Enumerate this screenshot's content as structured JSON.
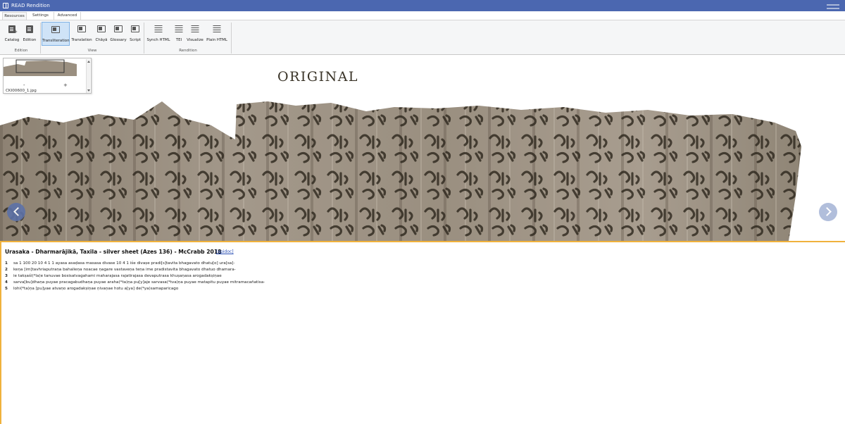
{
  "window": {
    "title": "READ Rendition"
  },
  "tabs": [
    "Resources",
    "Settings",
    "Advanced"
  ],
  "ribbon": {
    "edition_group": {
      "label": "Edition",
      "buttons": [
        "Catalog",
        "Edition"
      ]
    },
    "view_group": {
      "label": "View",
      "buttons": [
        "Transliteration",
        "Translation",
        "Chāyā",
        "Glossary",
        "Script"
      ],
      "selected": "Transliteration"
    },
    "rendition_group": {
      "label": "Rendition",
      "buttons": [
        "Synch HTML",
        "TEI",
        "Visualize",
        "Plain HTML"
      ]
    }
  },
  "viewer": {
    "image_label": "ORIGINAL",
    "thumbnail": {
      "filename": "CKI00600_1.jpg",
      "zoom_out": "-",
      "zoom_in": "+"
    }
  },
  "text": {
    "title": "Urasaka - Dharmarājikā, Taxila - silver sheet (Azes 136) - McCrabb 2018",
    "link": "[epidoc]",
    "lines": [
      {
        "num": "1",
        "text": "sa 1 100 20 10 4 1 1 ayasa asaḍasa masasa divase 10 4 1 iśe divaṣe pradi[s]tavita bhagavato dhatu[o] ura[sa]-"
      },
      {
        "num": "2",
        "text": "keṇa [im]tavhriaputraṇa bahalieṇa noacae ṇagare vastaveṇa teṇa ime pradistavita bhagavato dhatuo dhamara-"
      },
      {
        "num": "3",
        "text": "ie takṣaśi(*la)e tanuvae bosisatvagahami maharajasa rajatirajasa devaputrasa khuṣaṇasa arogadakṣiṇae"
      },
      {
        "num": "4",
        "text": "sarva[bu]dhaṇa puyae pracagabudhaṇa puyae araha(*ta)ṇa pu[y]aje sarvasa(*tva)ṇa puyae matapitu puyae mitramacañatisa-"
      },
      {
        "num": "5",
        "text": "lohi(*ta)ṇa [pu]yae atvaṇo arogadakṣiṇae ṇivaṇae hotu a[ya] de(*ya)samaparicago"
      }
    ]
  },
  "colors": {
    "titlebar": "#4b67b0",
    "panel_border": "#f0b23c",
    "selected": "#cfe3f7"
  }
}
